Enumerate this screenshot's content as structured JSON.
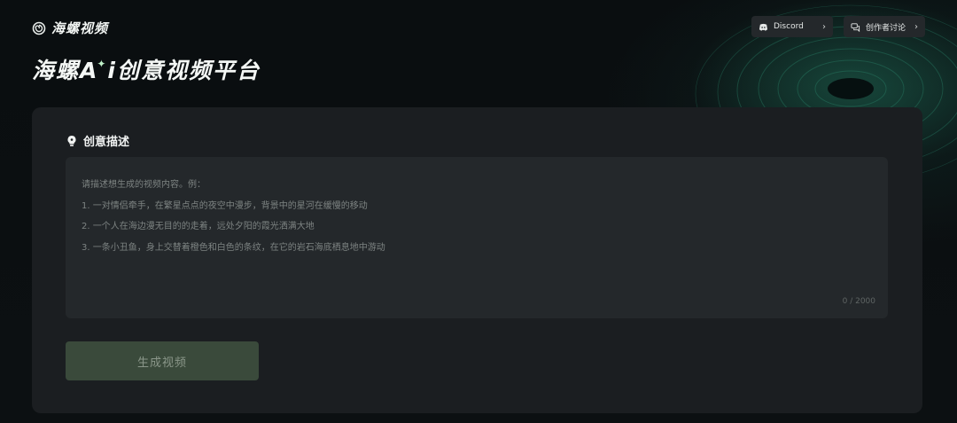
{
  "brand": {
    "name": "海螺视频"
  },
  "header": {
    "discord_label": "Discord",
    "forum_label": "创作者讨论"
  },
  "hero": {
    "title_a": "海螺A",
    "title_b": "i创意视频平台"
  },
  "prompt_section": {
    "title": "创意描述",
    "placeholder_lines": [
      "请描述想生成的视频内容。例：",
      "1. 一对情侣牵手，在繁星点点的夜空中漫步，背景中的星河在缓慢的移动",
      "2. 一个人在海边漫无目的的走着，远处夕阳的霞光洒满大地",
      "3. 一条小丑鱼，身上交替着橙色和白色的条纹，在它的岩石海底栖息地中游动"
    ],
    "char_count": "0 / 2000"
  },
  "actions": {
    "generate_label": "生成视频"
  },
  "icons": {
    "logo": "snail-logo-icon",
    "discord": "discord-icon",
    "forum": "chat-bubbles-icon",
    "bulb": "lightbulb-icon"
  },
  "colors": {
    "accent": "#bff0c8",
    "card_bg": "#1b1e21",
    "button_disabled": "#3a4a3b"
  }
}
